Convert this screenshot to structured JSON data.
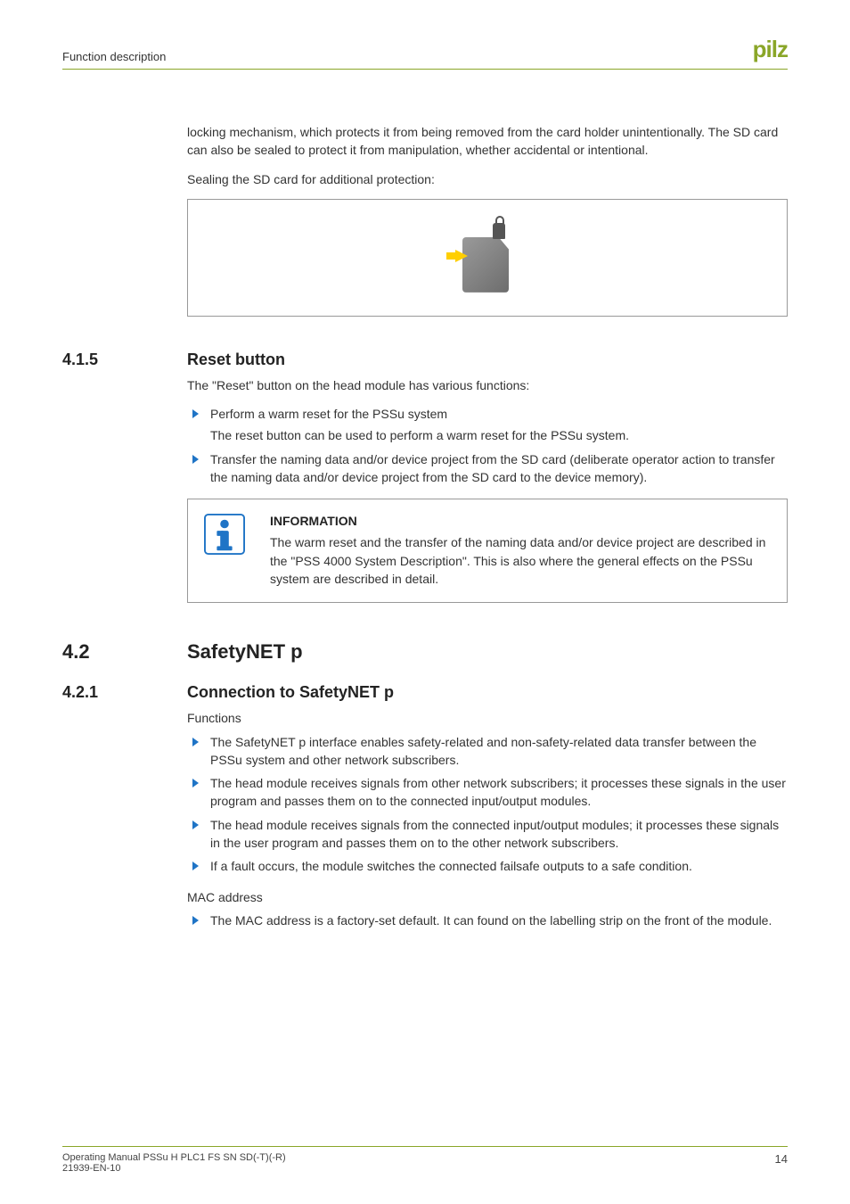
{
  "header": {
    "section": "Function description",
    "logo": "pilz"
  },
  "intro": {
    "p1": "locking mechanism, which protects it from being removed from the card holder unintentionally. The SD card can also be sealed to protect it from manipulation, whether accidental or intentional.",
    "p2": "Sealing the SD card for additional protection:"
  },
  "s415": {
    "num": "4.1.5",
    "title": "Reset button",
    "lead": "The \"Reset\" button on the head module has various functions:",
    "b1": "Perform a warm reset for the PSSu system",
    "b1_sub": "The reset button can be used to perform a warm reset for the PSSu system.",
    "b2": "Transfer the naming data and/or device project from the SD card (deliberate operator action to transfer the naming data and/or device project from the SD card to the device memory)."
  },
  "info": {
    "heading": "INFORMATION",
    "body": "The warm reset and the transfer of the naming data and/or device project are described in the \"PSS 4000 System Description\". This is also where the general effects on the PSSu system are described in detail."
  },
  "s42": {
    "num": "4.2",
    "title": "SafetyNET p"
  },
  "s421": {
    "num": "4.2.1",
    "title": "Connection to SafetyNET p",
    "lead": "Functions",
    "b1": "The SafetyNET p interface enables safety-related and non-safety-related data transfer between the PSSu system and other network subscribers.",
    "b2": "The head module receives signals from other network subscribers; it processes these signals in the user program and passes them on to the connected input/output modules.",
    "b3": "The head module receives signals from the connected input/output modules; it processes these signals in the user program and passes them on to the other network subscribers.",
    "b4": "If a fault occurs, the module switches the connected failsafe outputs to a safe condition.",
    "mac_h": "MAC address",
    "mac_b": "The MAC address is a factory-set default. It can found on the labelling strip on the front of the module."
  },
  "footer": {
    "line1": "Operating Manual PSSu H PLC1 FS SN SD(-T)(-R)",
    "line2": "21939-EN-10",
    "page": "14"
  }
}
